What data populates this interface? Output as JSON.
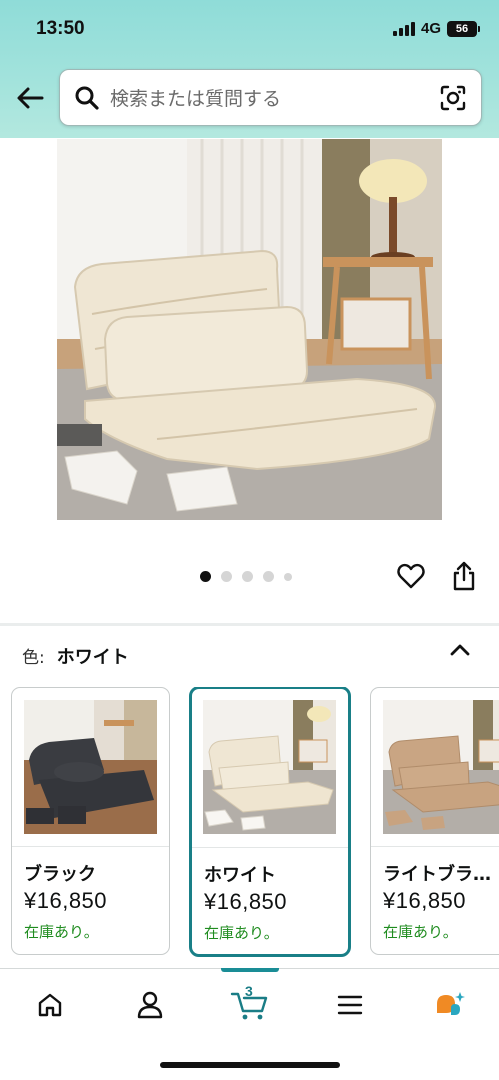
{
  "status_bar": {
    "time": "13:50",
    "network": "4G",
    "battery": "56"
  },
  "search": {
    "placeholder": "検索または質問する"
  },
  "product": {
    "image_dots_total": 5,
    "image_dots_active": 1
  },
  "variation": {
    "label": "色:",
    "selected_value": "ホワイト",
    "options": [
      {
        "name": "ブラック",
        "price": "¥16,850",
        "stock": "在庫あり。",
        "selected": false
      },
      {
        "name": "ホワイト",
        "price": "¥16,850",
        "stock": "在庫あり。",
        "selected": true
      },
      {
        "name": "ライトブラ…",
        "price": "¥16,850",
        "stock": "在庫あり。",
        "selected": false
      }
    ]
  },
  "bottom_nav": {
    "items": [
      "home-icon",
      "account-icon",
      "cart-icon",
      "menu-icon",
      "rufus-icon"
    ],
    "cart_count": "3",
    "active": "cart"
  },
  "colors": {
    "accent": "#197f87",
    "stock_green": "#1f8c1f",
    "header_top": "#8fdcd8"
  }
}
